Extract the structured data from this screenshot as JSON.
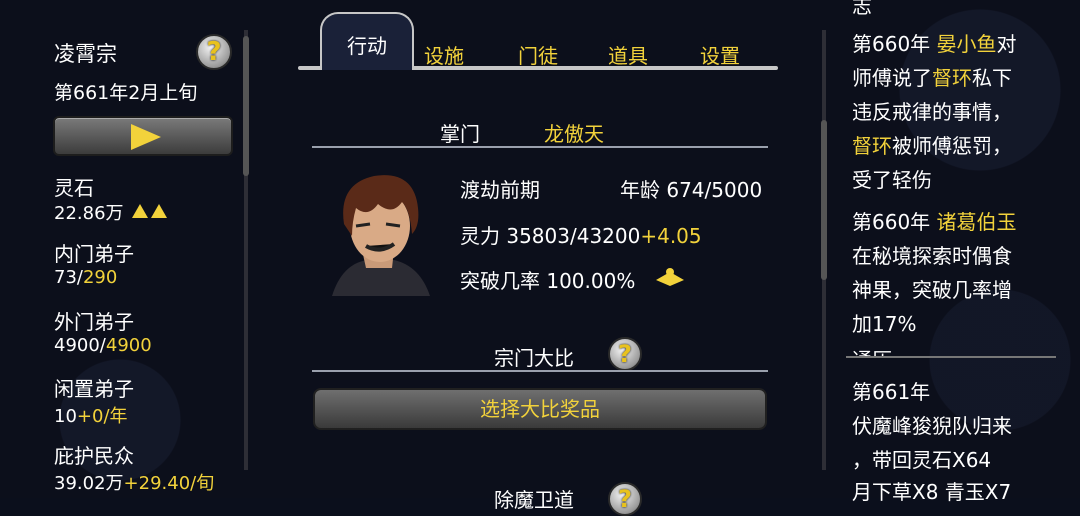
{
  "left": {
    "sect_name": "凌霄宗",
    "date": "第661年2月上旬",
    "help_glyph": "?",
    "stats": [
      {
        "label": "灵石",
        "value": "22.86万",
        "value_accent": "",
        "trend": "▲▲"
      },
      {
        "label": "内门弟子",
        "value": "73/",
        "value_accent": "290",
        "trend": ""
      },
      {
        "label": "外门弟子",
        "value": "4900/",
        "value_accent": "4900",
        "trend": ""
      },
      {
        "label": "闲置弟子",
        "value": "10",
        "value_accent": "+0/年",
        "trend": ""
      },
      {
        "label": "庇护民众",
        "value": "39.02万",
        "value_accent": "+29.40/旬",
        "trend": ""
      }
    ]
  },
  "center": {
    "tabs": [
      {
        "label": "行动",
        "active": true
      },
      {
        "label": "设施",
        "active": false
      },
      {
        "label": "门徒",
        "active": false
      },
      {
        "label": "道具",
        "active": false
      },
      {
        "label": "设置",
        "active": false
      }
    ],
    "leader_label": "掌门",
    "leader_name": "龙傲天",
    "realm": "渡劫前期",
    "age_label": "年龄",
    "age_value": "674/5000",
    "spirit_label": "灵力",
    "spirit_value": "35803/43200",
    "spirit_rate": "+4.05",
    "breakthrough_label": "突破几率",
    "breakthrough_value": "100.00%",
    "tournament_label": "宗门大比",
    "tournament_button": "选择大比奖品",
    "next_section": "除魔卫道"
  },
  "right": {
    "top_cut": "志",
    "log1": {
      "year": "第660年",
      "name": "晏小鱼",
      "suffix": "对"
    },
    "log1_lines": [
      "师傅说了",
      "违反戒律的事情，",
      "被师傅惩罚，",
      "受了轻伤"
    ],
    "log1_name2": "督环",
    "log1_tail": "私下",
    "log2": {
      "year": "第660年",
      "name": "诸葛伯玉"
    },
    "log2_lines": [
      "在秘境探索时偶食",
      "神果，突破几率增",
      "加17%"
    ],
    "section_cut": "通历",
    "log3_year": "第661年",
    "log3_lines": [
      "伏魔峰狻猊队归来",
      "，带回灵石X64",
      "月下草X8 青玉X7"
    ]
  },
  "colors": {
    "accent": "#f2d23b",
    "background": "#0c0f1b",
    "text": "#ffffff"
  }
}
